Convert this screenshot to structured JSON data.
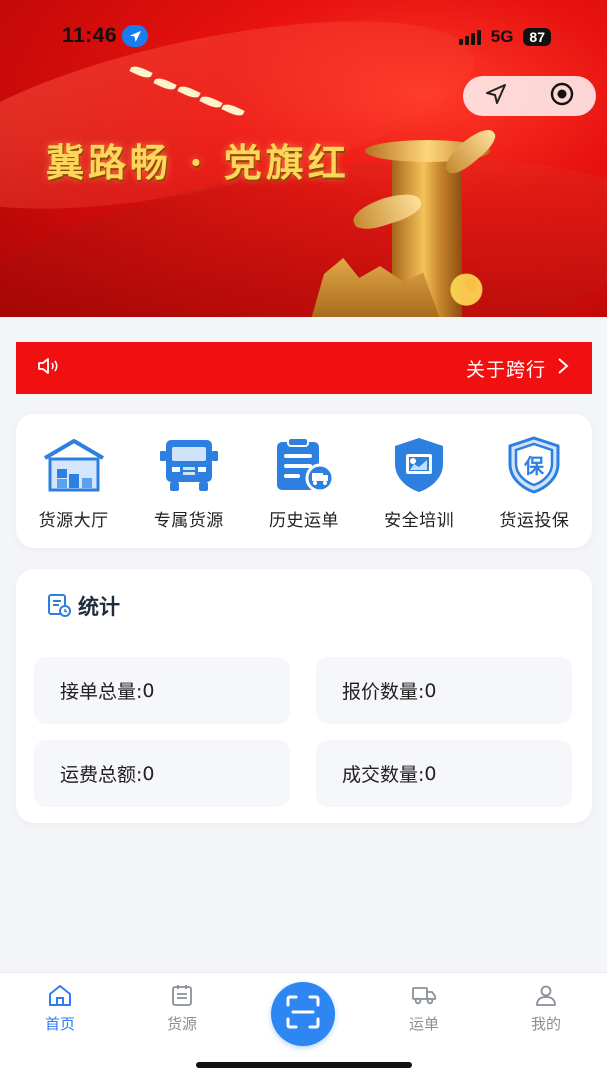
{
  "status_bar": {
    "time": "11:46",
    "network": "5G",
    "battery": "87"
  },
  "banner": {
    "title": "冀路畅 · 党旗红"
  },
  "notice": {
    "text": "关于跨行"
  },
  "quick_actions": [
    {
      "label": "货源大厅",
      "icon": "warehouse-icon"
    },
    {
      "label": "专属货源",
      "icon": "truck-icon"
    },
    {
      "label": "历史运单",
      "icon": "waybill-history-icon"
    },
    {
      "label": "安全培训",
      "icon": "safety-training-icon"
    },
    {
      "label": "货运投保",
      "icon": "insurance-icon"
    }
  ],
  "stats": {
    "title": "统计",
    "items": [
      {
        "label": "接单总量:",
        "value": "0"
      },
      {
        "label": "报价数量:",
        "value": "0"
      },
      {
        "label": "运费总额:",
        "value": "0"
      },
      {
        "label": "成交数量:",
        "value": "0"
      }
    ]
  },
  "tabbar": {
    "tabs": [
      {
        "label": "首页",
        "icon": "home-icon",
        "active": true
      },
      {
        "label": "货源",
        "icon": "cargo-list-icon",
        "active": false
      },
      {
        "label": "运单",
        "icon": "truck-icon",
        "active": false
      },
      {
        "label": "我的",
        "icon": "user-icon",
        "active": false
      }
    ],
    "center_icon": "scan-icon"
  },
  "colors": {
    "primary": "#2e7cf6",
    "notice_red": "#f20f0f",
    "banner_red": "#e8120f"
  }
}
